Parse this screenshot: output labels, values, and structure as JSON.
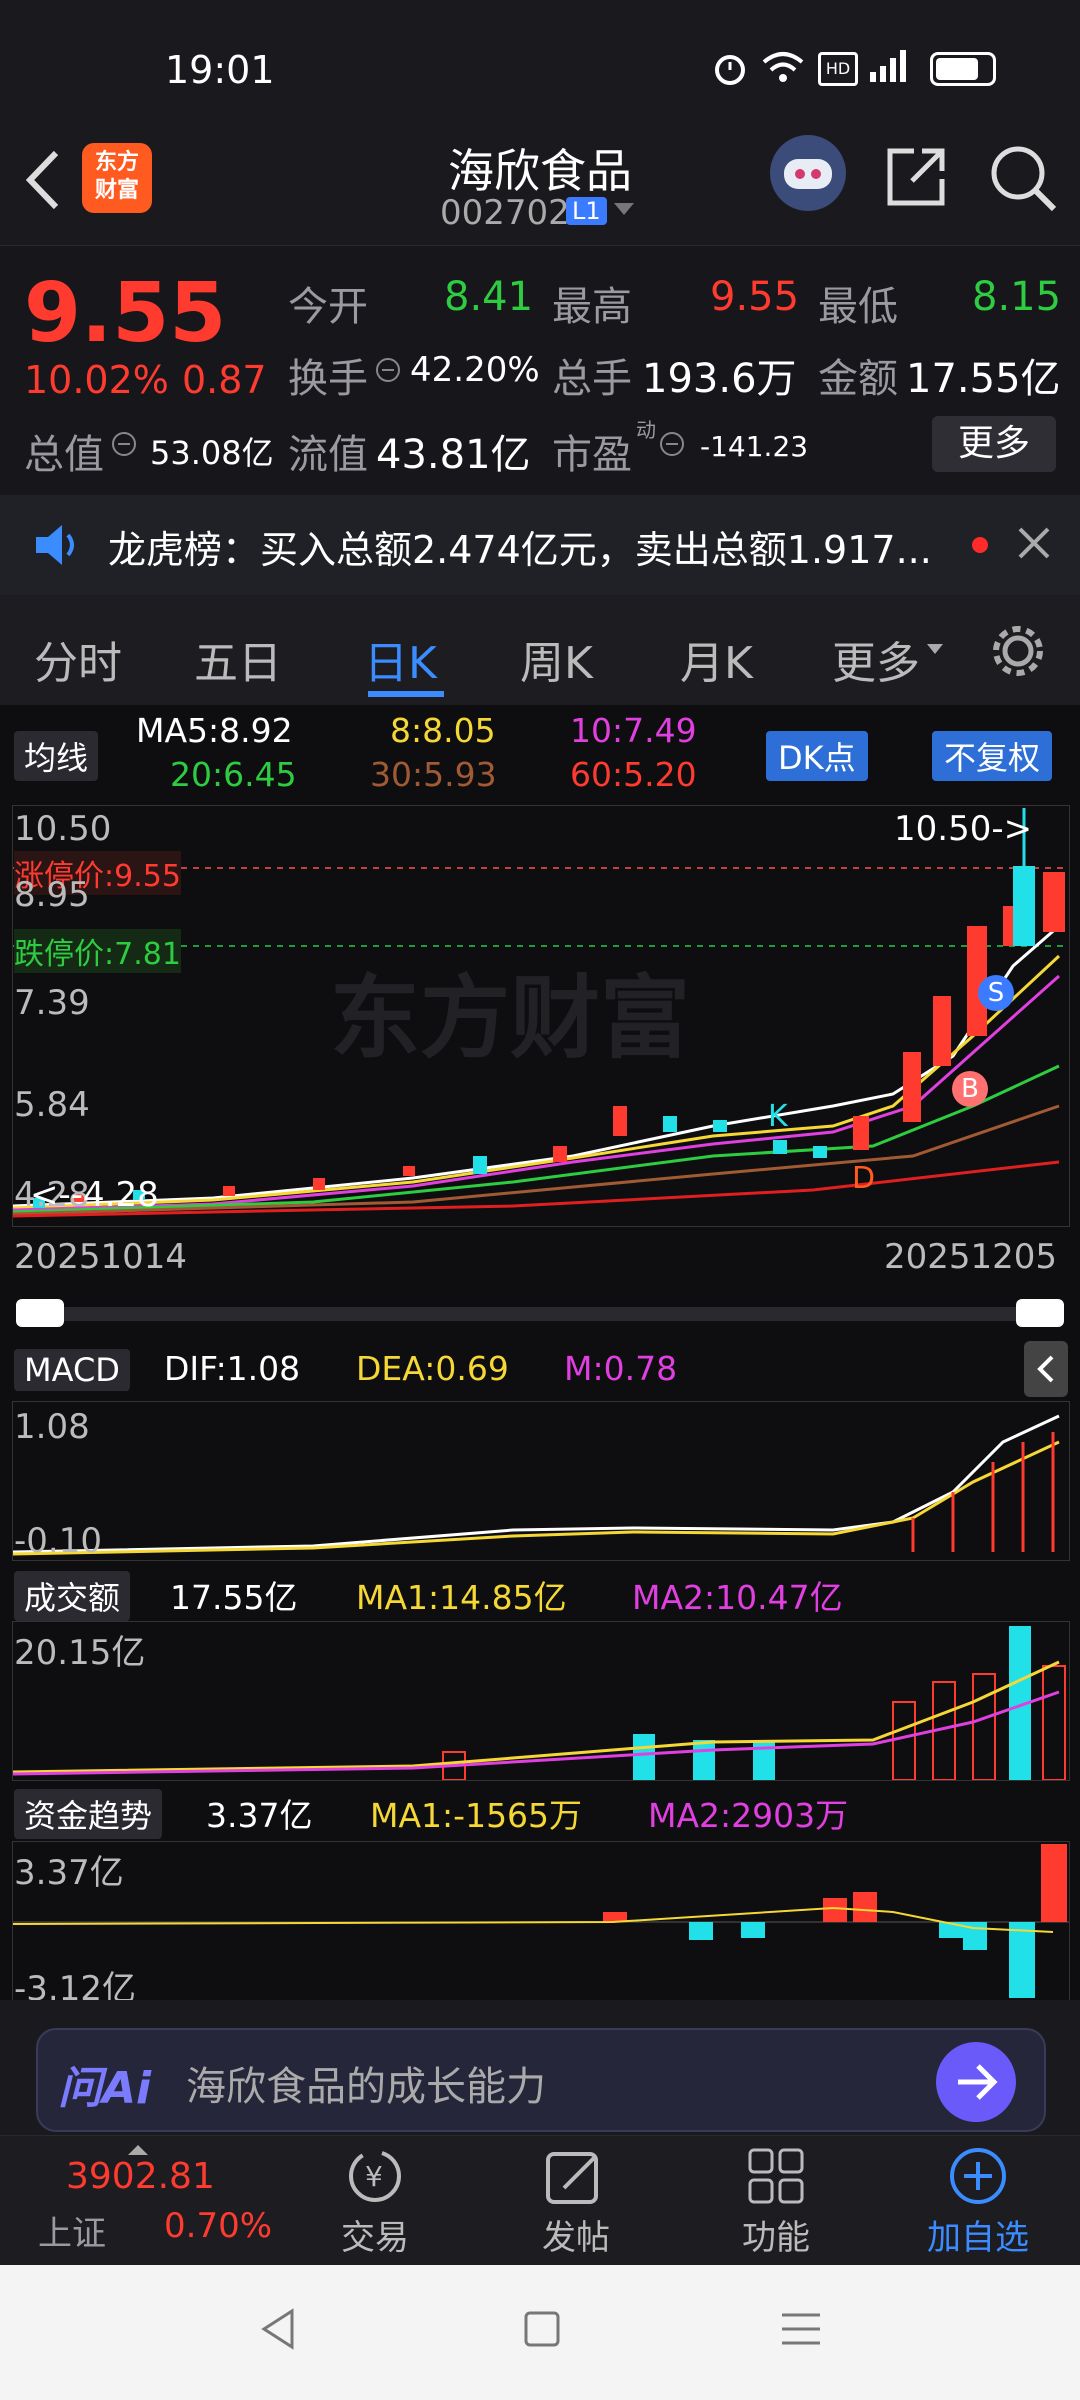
{
  "status": {
    "time": "19:01",
    "battery": "battery"
  },
  "header": {
    "stock_name": "海欣食品",
    "stock_code": "002702",
    "level_badge": "L1",
    "app_logo": "东方\n财富"
  },
  "quote": {
    "price": "9.55",
    "change_pct": "10.02%",
    "change_abs": "0.87",
    "open_label": "今开",
    "open": "8.41",
    "high_label": "最高",
    "high": "9.55",
    "low_label": "最低",
    "low": "8.15",
    "turnover_label": "换手",
    "turnover": "42.20%",
    "volume_label": "总手",
    "volume": "193.6万",
    "amount_label": "金额",
    "amount": "17.55亿",
    "total_mv_label": "总值",
    "total_mv": "53.08亿",
    "float_mv_label": "流值",
    "float_mv": "43.81亿",
    "pe_label": "市盈",
    "pe_sup": "动",
    "pe": "-141.23",
    "more_label": "更多"
  },
  "ticker": {
    "text": "龙虎榜：买入总额2.474亿元，卖出总额1.917..."
  },
  "tabs": [
    {
      "label": "分时"
    },
    {
      "label": "五日"
    },
    {
      "label": "日K"
    },
    {
      "label": "周K"
    },
    {
      "label": "月K"
    },
    {
      "label": "更多"
    }
  ],
  "ma_panel": {
    "label": "均线",
    "ma5": "MA5:8.92",
    "ma8": "8:8.05",
    "ma10": "10:7.49",
    "ma20": "20:6.45",
    "ma30": "30:5.93",
    "ma60": "60:5.20",
    "dk_label": "DK点",
    "adjust_label": "不复权"
  },
  "kchart": {
    "y_top": "10.50",
    "y_2": "8.95",
    "y_3": "7.39",
    "y_4": "5.84",
    "y_5": "4.28",
    "limit_up": "涨停价:9.55",
    "limit_down": "跌停价:7.81",
    "max_marker": "10.50->",
    "min_marker": "<--4.28",
    "date_start": "20251014",
    "date_end": "20251205",
    "watermark": "东方财富",
    "badge_s": "S",
    "badge_b": "B",
    "badge_k": "K",
    "badge_d": "D"
  },
  "macd": {
    "label": "MACD",
    "dif": "DIF:1.08",
    "dea": "DEA:0.69",
    "m": "M:0.78",
    "y_top": "1.08",
    "y_bottom": "-0.10"
  },
  "volume": {
    "label": "成交额",
    "value": "17.55亿",
    "ma1": "MA1:14.85亿",
    "ma2": "MA2:10.47亿",
    "y_top": "20.15亿"
  },
  "fund": {
    "label": "资金趋势",
    "value": "3.37亿",
    "ma1": "MA1:-1565万",
    "ma2": "MA2:2903万",
    "y_top": "3.37亿",
    "y_bottom": "-3.12亿"
  },
  "ai": {
    "logo": "问Ai",
    "prompt": "海欣食品的成长能力"
  },
  "bottom_nav": {
    "index_value": "3902.81",
    "index_name": "上证",
    "index_pct": "0.70%",
    "trade": "交易",
    "post": "发帖",
    "func": "功能",
    "add": "加自选"
  },
  "colors": {
    "up": "#ff3b30",
    "down": "#22e0e8",
    "accent": "#3a7bff"
  }
}
